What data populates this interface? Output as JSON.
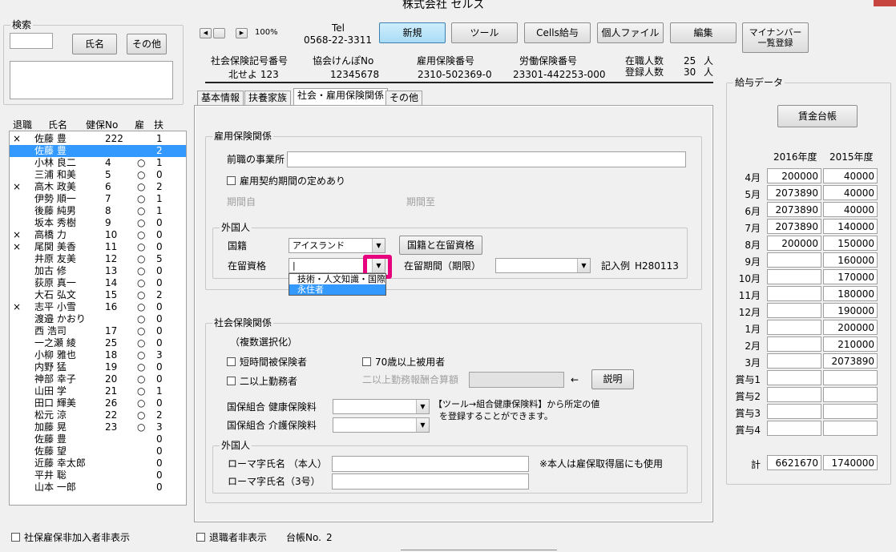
{
  "window_title": "株式会社 セルズ",
  "search": {
    "label": "検索",
    "name_button": "氏名",
    "other_button": "その他"
  },
  "employee_headers": {
    "retired": "退職",
    "name": "氏名",
    "health_no": "健保No",
    "employ": "雇",
    "dependents": "扶"
  },
  "employees": [
    {
      "ret": "×",
      "name": "佐藤 豊",
      "no": "222",
      "emp": "",
      "dep": "1"
    },
    {
      "ret": "",
      "name": "佐藤 豊",
      "no": "",
      "emp": "",
      "dep": "2"
    },
    {
      "ret": "",
      "name": "小林 良二",
      "no": "4",
      "emp": "○",
      "dep": "1"
    },
    {
      "ret": "",
      "name": "三浦 和美",
      "no": "5",
      "emp": "○",
      "dep": "0"
    },
    {
      "ret": "×",
      "name": "高木 政美",
      "no": "6",
      "emp": "○",
      "dep": "2"
    },
    {
      "ret": "",
      "name": "伊勢 順一",
      "no": "7",
      "emp": "○",
      "dep": "1"
    },
    {
      "ret": "",
      "name": "後藤 純男",
      "no": "8",
      "emp": "○",
      "dep": "1"
    },
    {
      "ret": "",
      "name": "坂本 秀樹",
      "no": "9",
      "emp": "○",
      "dep": "0"
    },
    {
      "ret": "×",
      "name": "高橋 力",
      "no": "10",
      "emp": "○",
      "dep": "0"
    },
    {
      "ret": "×",
      "name": "尾関 美香",
      "no": "11",
      "emp": "○",
      "dep": "0"
    },
    {
      "ret": "",
      "name": "井原 友美",
      "no": "12",
      "emp": "○",
      "dep": "5"
    },
    {
      "ret": "",
      "name": "加古 修",
      "no": "13",
      "emp": "○",
      "dep": "0"
    },
    {
      "ret": "",
      "name": "荻原 真一",
      "no": "14",
      "emp": "○",
      "dep": "0"
    },
    {
      "ret": "",
      "name": "大石 弘文",
      "no": "15",
      "emp": "○",
      "dep": "2"
    },
    {
      "ret": "×",
      "name": "志平 小雪",
      "no": "16",
      "emp": "○",
      "dep": "0"
    },
    {
      "ret": "",
      "name": "渡邉 かおり",
      "no": "",
      "emp": "○",
      "dep": "0"
    },
    {
      "ret": "",
      "name": "西 浩司",
      "no": "17",
      "emp": "○",
      "dep": "0"
    },
    {
      "ret": "",
      "name": "一之瀬 綾",
      "no": "25",
      "emp": "○",
      "dep": "0"
    },
    {
      "ret": "",
      "name": "小柳 雅也",
      "no": "18",
      "emp": "○",
      "dep": "3"
    },
    {
      "ret": "",
      "name": "内野 猛",
      "no": "19",
      "emp": "○",
      "dep": "0"
    },
    {
      "ret": "",
      "name": "神部 幸子",
      "no": "20",
      "emp": "○",
      "dep": "0"
    },
    {
      "ret": "",
      "name": "山田 学",
      "no": "21",
      "emp": "○",
      "dep": "1"
    },
    {
      "ret": "",
      "name": "田口 輝美",
      "no": "26",
      "emp": "○",
      "dep": "0"
    },
    {
      "ret": "",
      "name": "松元 涼",
      "no": "22",
      "emp": "○",
      "dep": "2"
    },
    {
      "ret": "",
      "name": "加藤 晃",
      "no": "23",
      "emp": "○",
      "dep": "3"
    },
    {
      "ret": "",
      "name": "佐藤 豊",
      "no": "",
      "emp": "",
      "dep": "0"
    },
    {
      "ret": "",
      "name": "佐藤 望",
      "no": "",
      "emp": "",
      "dep": "0"
    },
    {
      "ret": "",
      "name": "近藤 幸太郎",
      "no": "",
      "emp": "",
      "dep": "0"
    },
    {
      "ret": "",
      "name": "平井 聡",
      "no": "",
      "emp": "",
      "dep": "0"
    },
    {
      "ret": "",
      "name": "山本 一郎",
      "no": "",
      "emp": "",
      "dep": "0"
    }
  ],
  "bottom_left_checkbox": "社保雇保非加入者非表示",
  "bottom_mid_checkbox": "退職者非表示",
  "ledger_no_label": "台帳No.",
  "ledger_no": "2",
  "zoom": "100%",
  "tel_label": "Tel",
  "tel": "0568-22-3311",
  "toolbar": {
    "new": "新規",
    "tool": "ツール",
    "cells_pay": "Cells給与",
    "personal_file": "個人ファイル",
    "edit": "編集",
    "mynumber_1": "マイナンバー",
    "mynumber_2": "一覧登録"
  },
  "info": {
    "social_ins_label": "社会保険記号番号",
    "social_ins_value": "北せよ 123",
    "kyokai_label": "協会けんぽNo",
    "kyokai_value": "12345678",
    "employ_ins_label": "雇用保険番号",
    "employ_ins_value": "2310-502369-0",
    "labor_ins_label": "労働保険番号",
    "labor_ins_value": "23301-442253-000",
    "employed_label": "在職人数",
    "employed_value": "25",
    "employed_unit": "人",
    "registered_label": "登録人数",
    "registered_value": "30",
    "registered_unit": "人"
  },
  "tabs": [
    "基本情報",
    "扶養家族",
    "社会・雇用保険関係",
    "その他"
  ],
  "employment_section": {
    "title": "雇用保険関係",
    "prev_office_label": "前職の事業所",
    "contract_checkbox": "雇用契約期間の定めあり",
    "period_from": "期間自",
    "period_to": "期間至",
    "foreigner_title": "外国人",
    "nationality_label": "国籍",
    "nationality_value": "アイスランド",
    "nationality_button": "国籍と在留資格",
    "status_label": "在留資格",
    "status_value": "|",
    "stay_period_label": "在留期間（期限）",
    "example_label": "記入例",
    "example_value": "H280113",
    "dropdown_options": [
      "技術・人文知識・国際",
      "永住者"
    ]
  },
  "social_section": {
    "title": "社会保険関係",
    "multi_select": "（複数選択化）",
    "short_time": "短時間被保険者",
    "over70": "70歳以上被用者",
    "multi_office": "二以上勤務者",
    "multi_office_total": "二以上勤務報酬合算額",
    "arrow": "←",
    "explain_button": "説明",
    "health_label": "国保組合  健康保険料",
    "care_label": "国保組合  介護保険料",
    "note_1": "【ツール→組合健康保険料】から所定の値",
    "note_2": "を登録することができます。",
    "foreigner_title": "外国人",
    "romaji_self": "ローマ字氏名  （本人）",
    "romaji_self_note": "※本人は雇保取得届にも使用",
    "romaji_3": "ローマ字氏名（3号）"
  },
  "salary": {
    "title": "給与データ",
    "ledger_button": "賃金台帳",
    "year1": "2016年度",
    "year2": "2015年度",
    "rows": [
      {
        "m": "4月",
        "a": "200000",
        "b": "40000"
      },
      {
        "m": "5月",
        "a": "2073890",
        "b": "40000"
      },
      {
        "m": "6月",
        "a": "2073890",
        "b": "40000"
      },
      {
        "m": "7月",
        "a": "2073890",
        "b": "140000"
      },
      {
        "m": "8月",
        "a": "200000",
        "b": "150000"
      },
      {
        "m": "9月",
        "a": "",
        "b": "160000"
      },
      {
        "m": "10月",
        "a": "",
        "b": "170000"
      },
      {
        "m": "11月",
        "a": "",
        "b": "180000"
      },
      {
        "m": "12月",
        "a": "",
        "b": "190000"
      },
      {
        "m": "1月",
        "a": "",
        "b": "200000"
      },
      {
        "m": "2月",
        "a": "",
        "b": "210000"
      },
      {
        "m": "3月",
        "a": "",
        "b": "2073890"
      },
      {
        "m": "賞与1",
        "a": "",
        "b": ""
      },
      {
        "m": "賞与2",
        "a": "",
        "b": ""
      },
      {
        "m": "賞与3",
        "a": "",
        "b": ""
      },
      {
        "m": "賞与4",
        "a": "",
        "b": ""
      }
    ],
    "total_label": "計",
    "total_a": "6621670",
    "total_b": "1740000"
  },
  "colors": {
    "selection": "#3399ff",
    "highlight_button": "#a9dcf5",
    "focus_box": "#e6007e"
  }
}
